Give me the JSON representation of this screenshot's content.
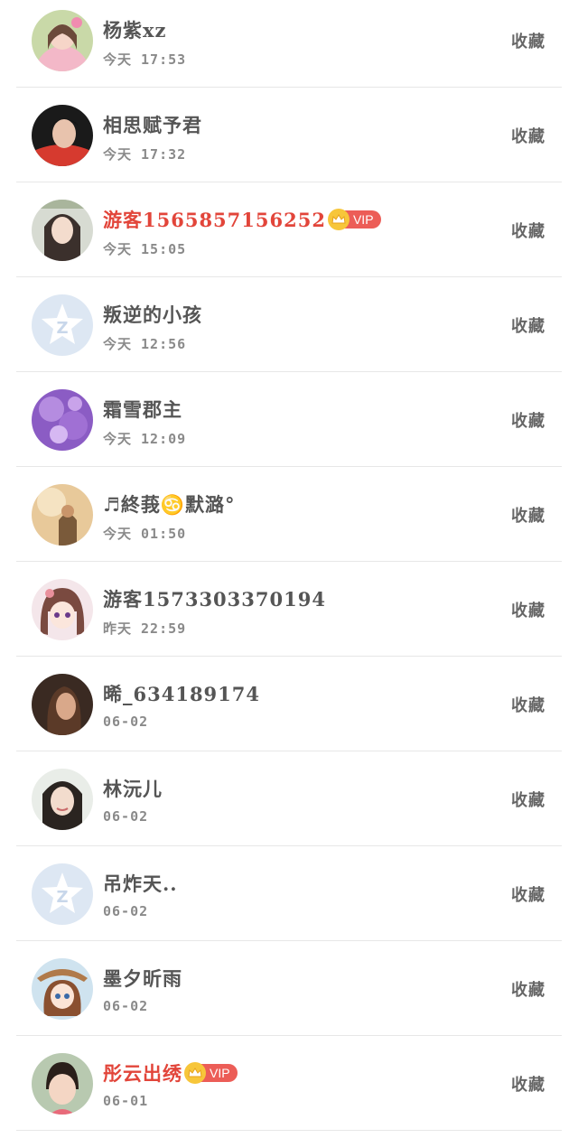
{
  "favorite_label": "收藏",
  "vip_label": "VIP",
  "colors": {
    "vip_name": "#e2453a",
    "vip_tag": "#ec5d57",
    "crown": "#f7c63a",
    "name": "#555555",
    "time": "#8a8a8a",
    "divider": "#e7e7e7"
  },
  "users": [
    {
      "name": "杨紫xz",
      "time": "今天 17:53",
      "vip": false,
      "avatar": "photo-girl-pink"
    },
    {
      "name": "相思赋予君",
      "time": "今天 17:32",
      "vip": false,
      "avatar": "photo-boy-red"
    },
    {
      "name": "游客1565857156252",
      "time": "今天 15:05",
      "vip": true,
      "avatar": "photo-girl-longhair"
    },
    {
      "name": "叛逆的小孩",
      "time": "今天 12:56",
      "vip": false,
      "avatar": "default-qzone-avatar"
    },
    {
      "name": "霜雪郡主",
      "time": "今天 12:09",
      "vip": false,
      "avatar": "purple-flower-avatar"
    },
    {
      "name": "♬終莪♋默潞°",
      "time": "今天 01:50",
      "vip": false,
      "avatar": "photo-sepia-girl"
    },
    {
      "name": "游客1573303370194",
      "time": "昨天 22:59",
      "vip": false,
      "avatar": "anime-girl-avatar"
    },
    {
      "name": "晞_634189174",
      "time": "06-02",
      "vip": false,
      "avatar": "photo-woman-profile"
    },
    {
      "name": "林沅儿",
      "time": "06-02",
      "vip": false,
      "avatar": "photo-girl-smile"
    },
    {
      "name": "吊炸天..",
      "time": "06-02",
      "vip": false,
      "avatar": "default-qzone-avatar"
    },
    {
      "name": "墨夕昕雨",
      "time": "06-02",
      "vip": false,
      "avatar": "anime-hat-girl-avatar"
    },
    {
      "name": "彤云出绣",
      "time": "06-01",
      "vip": true,
      "avatar": "photo-child"
    }
  ]
}
